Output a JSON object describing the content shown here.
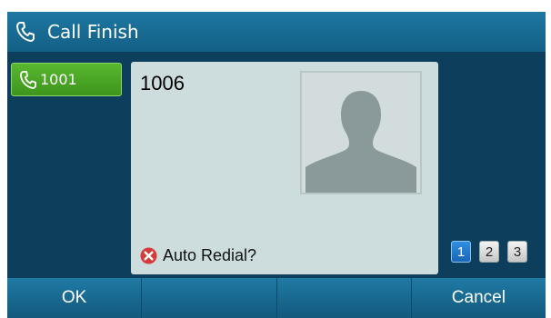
{
  "titlebar": {
    "title": "Call Finish",
    "icon": "phone-handset-icon"
  },
  "account": {
    "label": "1001",
    "icon": "phone-handset-icon"
  },
  "call": {
    "number": "1006",
    "redial_label": "Auto Redial?",
    "redial_icon": "close-icon"
  },
  "pages": [
    {
      "label": "1",
      "active": true
    },
    {
      "label": "2",
      "active": false
    },
    {
      "label": "3",
      "active": false
    }
  ],
  "softkeys": [
    "OK",
    "",
    "",
    "Cancel"
  ],
  "colors": {
    "background": "#0d3e5c",
    "titlebar": "#1b6f98",
    "account_button": "#4ca626",
    "card": "#cddddd",
    "page_active": "#2478cc",
    "softkey_bar": "#186c94"
  }
}
